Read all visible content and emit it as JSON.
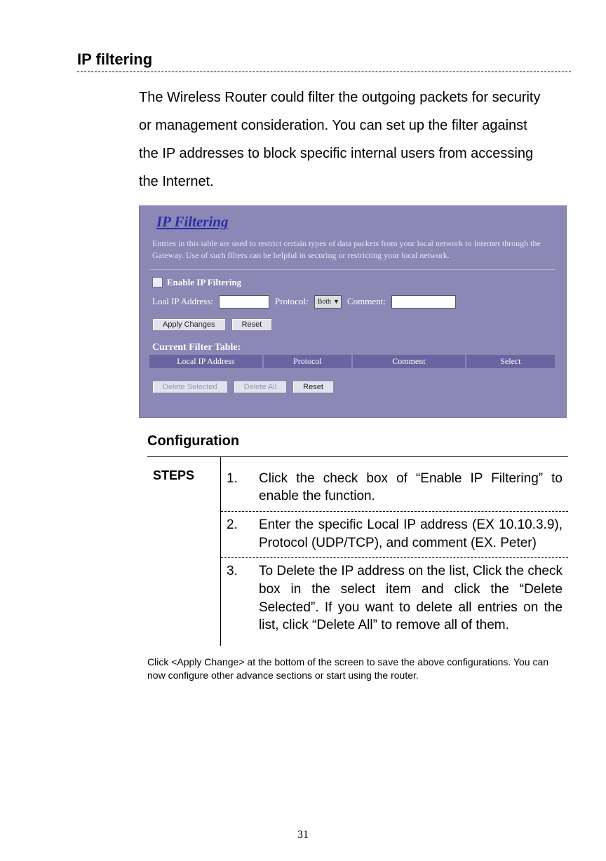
{
  "page": {
    "title": "IP filtering",
    "intro": "The Wireless Router could filter the outgoing packets for security or management consideration. You can set up the filter against the IP addresses to block specific internal users from accessing the Internet.",
    "number": "31"
  },
  "shot": {
    "title": "IP Filtering",
    "desc": "Entries in this table are used to restrict certain types of data packets from your local network to Internet through the Gateway. Use of such filters can be helpful in securing or restricting your local network.",
    "enable_label": "Enable IP Filtering",
    "local_ip_label": "Loal IP Address:",
    "protocol_label": "Protocol:",
    "protocol_value": "Both",
    "comment_label": "Comment:",
    "apply_btn": "Apply Changes",
    "reset_btn": "Reset",
    "table_title": "Current Filter Table:",
    "cols": {
      "c1": "Local IP Address",
      "c2": "Protocol",
      "c3": "Comment",
      "c4": "Select"
    },
    "del_sel": "Delete Selected",
    "del_all": "Delete All",
    "reset2": "Reset"
  },
  "config": {
    "heading": "Configuration",
    "steps_label": "STEPS",
    "steps": [
      {
        "n": "1.",
        "t": "Click the check box of “Enable IP Filtering” to enable the function."
      },
      {
        "n": "2.",
        "t": "Enter the specific Local IP address (EX 10.10.3.9), Protocol (UDP/TCP), and comment (EX. Peter)"
      },
      {
        "n": "3.",
        "t": "To Delete the IP address on the list, Click the check box in the select item and click the “Delete Selected”. If you want to delete all entries on the list, click “Delete All” to remove all of them."
      }
    ],
    "note": "Click <Apply Change> at the bottom of the screen to save the above configurations. You can now configure other advance sections or start using the router."
  }
}
